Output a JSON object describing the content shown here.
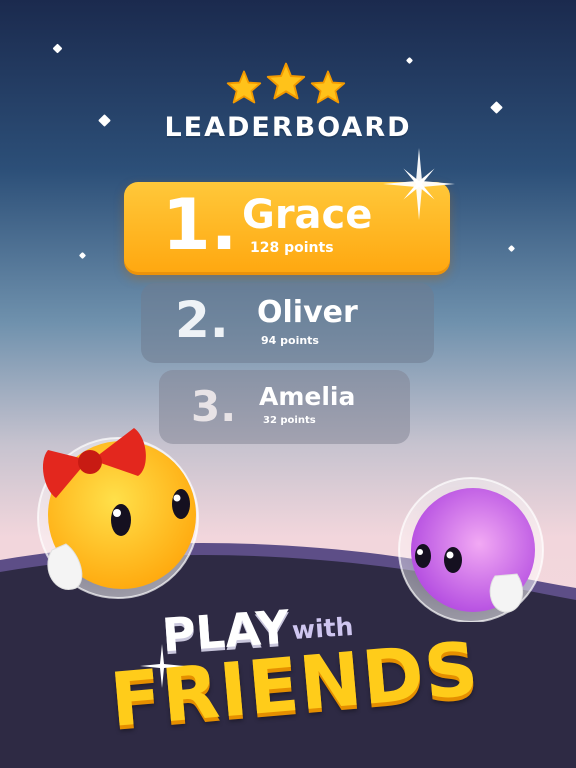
{
  "screen": {
    "stars_awarded": 3,
    "stars_total": 3
  },
  "leaderboard": {
    "title": "LEADERBOARD",
    "entries": [
      {
        "rank": "1.",
        "name": "Grace",
        "points": "128 points"
      },
      {
        "rank": "2.",
        "name": "Oliver",
        "points": "94 points"
      },
      {
        "rank": "3.",
        "name": "Amelia",
        "points": "32 points"
      }
    ]
  },
  "headline": {
    "play": "PLAY",
    "with": "with",
    "friends": "FRIENDS"
  },
  "colors": {
    "gold_accent": "#ffb21f",
    "star_fill": "#ffc21a",
    "ground": "#2e2a44",
    "friends_text": "#ffcc1a"
  }
}
